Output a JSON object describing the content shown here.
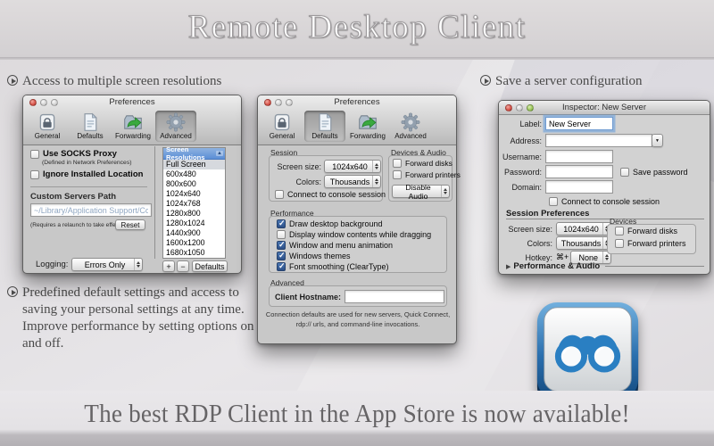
{
  "page": {
    "title_banner": "Remote Desktop Client",
    "bottom_banner": "The best RDP Client in the App Store is now available!"
  },
  "callouts": {
    "left_top": "Access to multiple screen resolutions",
    "right_top": "Save a server configuration",
    "left_bottom": "Predefined default settings and access to saving your personal settings at any time. Improve performance by setting options on and off."
  },
  "toolbar": {
    "general": "General",
    "defaults": "Defaults",
    "forwarding": "Forwarding",
    "advanced": "Advanced"
  },
  "glyphs": {
    "sort_asc": "▲",
    "combo_arrow": "▼"
  },
  "advanced_prefs": {
    "window_title": "Preferences",
    "selected_tab": "Advanced",
    "socks_label": "Use SOCKS Proxy",
    "socks_note": "(Defined in Network Preferences)",
    "socks_checked": false,
    "ignore_label": "Ignore Installed Location",
    "ignore_checked": false,
    "custom_path_label": "Custom Servers Path",
    "custom_path_placeholder": "~/Library/Application Support/CoRD/",
    "relaunch_note": "(Requires a relaunch to take effect)",
    "reset_label": "Reset",
    "logging_label": "Logging:",
    "logging_value": "Errors Only",
    "table_header": "Screen Resolutions",
    "resolutions": [
      "Full Screen",
      "600x480",
      "800x600",
      "1024x640",
      "1024x768",
      "1280x800",
      "1280x1024",
      "1440x900",
      "1600x1200",
      "1680x1050"
    ],
    "add_button": "+",
    "remove_button": "−",
    "defaults_button": "Defaults"
  },
  "default_prefs": {
    "window_title": "Preferences",
    "selected_tab": "Defaults",
    "session_group": "Session",
    "screen_size_label": "Screen size:",
    "screen_size_value": "1024x640",
    "colors_label": "Colors:",
    "colors_value": "Thousands",
    "console_label": "Connect to console session",
    "console_checked": false,
    "devices_audio_group": "Devices & Audio",
    "forward_disks_label": "Forward disks",
    "forward_disks_checked": false,
    "forward_printers_label": "Forward printers",
    "forward_printers_checked": false,
    "audio_value": "Disable Audio",
    "performance_group": "Performance",
    "perf_items": [
      {
        "label": "Draw desktop background",
        "checked": true
      },
      {
        "label": "Display window contents while dragging",
        "checked": false
      },
      {
        "label": "Window and menu animation",
        "checked": true
      },
      {
        "label": "Windows themes",
        "checked": true
      },
      {
        "label": "Font smoothing (ClearType)",
        "checked": true
      }
    ],
    "advanced_group": "Advanced",
    "hostname_label": "Client Hostname:",
    "hostname_value": "",
    "footer_note": "Connection defaults are used for new servers, Quick Connect, rdp:// urls, and command-line invocations."
  },
  "inspector": {
    "window_title": "Inspector: New Server",
    "label_label": "Label:",
    "label_value": "New Server",
    "address_label": "Address:",
    "address_value": "",
    "username_label": "Username:",
    "username_value": "",
    "password_label": "Password:",
    "password_value": "",
    "save_password_label": "Save password",
    "save_password_checked": false,
    "domain_label": "Domain:",
    "domain_value": "",
    "console_label": "Connect to console session",
    "console_checked": false,
    "session_prefs_heading": "Session Preferences",
    "screen_size_label": "Screen size:",
    "screen_size_value": "1024x640",
    "colors_label": "Colors:",
    "colors_value": "Thousands",
    "hotkey_label": "Hotkey:",
    "hotkey_prefix": "⌘+",
    "hotkey_value": "None",
    "devices_group": "Devices",
    "forward_disks_label": "Forward disks",
    "forward_disks_checked": false,
    "forward_printers_label": "Forward printers",
    "forward_printers_checked": false,
    "performance_audio_heading": "Performance & Audio"
  },
  "colors": {
    "table_header_blue": "#5b8ed6",
    "checkbox_checked_blue": "#3a67a6",
    "app_icon_blue": "#2a7fc2",
    "focus_ring_blue": "#7ba7d9"
  }
}
